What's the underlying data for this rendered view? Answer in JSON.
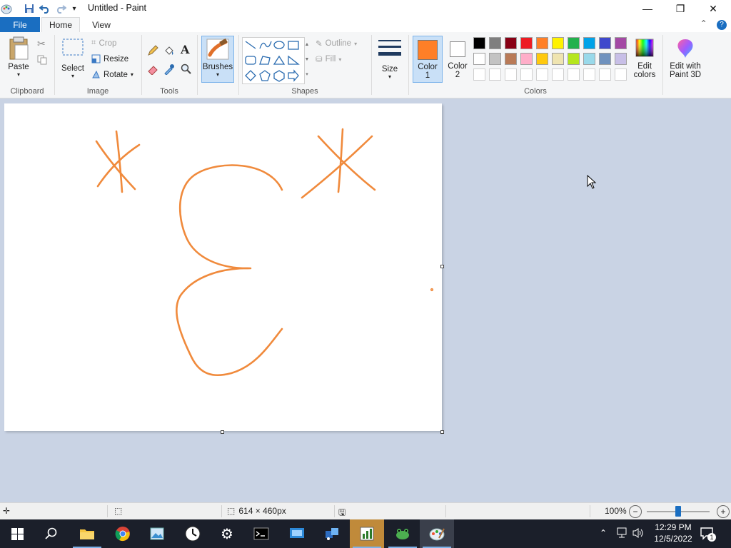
{
  "window": {
    "title": "Untitled - Paint",
    "minimize_glyph": "—",
    "restore_glyph": "❐",
    "close_glyph": "✕"
  },
  "tabs": {
    "file": "File",
    "home": "Home",
    "view": "View"
  },
  "ribbon": {
    "clipboard": {
      "label": "Clipboard",
      "paste": "Paste"
    },
    "image": {
      "label": "Image",
      "select": "Select",
      "crop": "Crop",
      "resize": "Resize",
      "rotate": "Rotate"
    },
    "tools": {
      "label": "Tools"
    },
    "brushes": {
      "label": "Brushes"
    },
    "shapes": {
      "label": "Shapes",
      "outline": "Outline",
      "fill": "Fill"
    },
    "size": {
      "label": "Size"
    },
    "colors": {
      "label": "Colors",
      "color1": "Color",
      "color1_num": "1",
      "color2": "Color",
      "color2_num": "2",
      "edit_colors_1": "Edit",
      "edit_colors_2": "colors",
      "paint3d_1": "Edit with",
      "paint3d_2": "Paint 3D",
      "color1_value": "#ff7f27",
      "color2_value": "#ffffff",
      "palette_row1": [
        "#000000",
        "#7f7f7f",
        "#880015",
        "#ed1c24",
        "#ff7f27",
        "#fff200",
        "#22b14c",
        "#00a2e8",
        "#3f48cc",
        "#a349a4"
      ],
      "palette_row2": [
        "#ffffff",
        "#c3c3c3",
        "#b97a57",
        "#ffaec9",
        "#ffc90e",
        "#efe4b0",
        "#b5e61d",
        "#99d9ea",
        "#7092be",
        "#c8bfe7"
      ]
    }
  },
  "drawing": {
    "stroke_color": "#f08a3c"
  },
  "status": {
    "canvas_size": "614 × 460px",
    "zoom": "100%",
    "zoom_level": 0.5
  },
  "taskbar": {
    "time": "12:29 PM",
    "date": "12/5/2022",
    "notification_count": "1"
  }
}
